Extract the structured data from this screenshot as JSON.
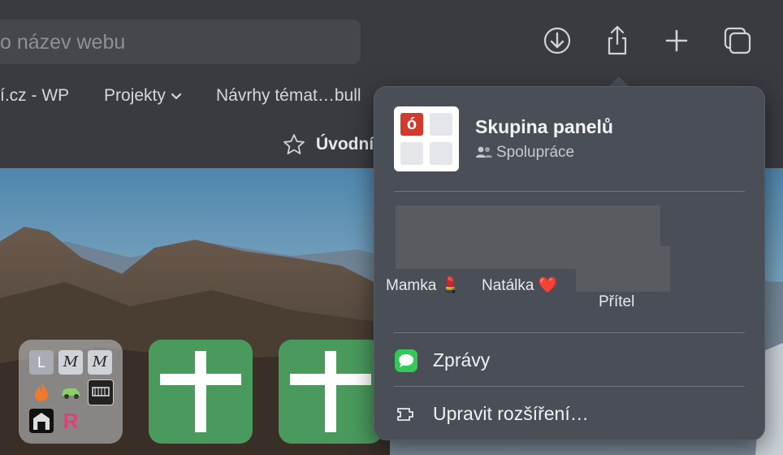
{
  "window": {
    "url_placeholder": "o název webu"
  },
  "bookmarks": [
    {
      "label": "í.cz - WP",
      "has_menu": false
    },
    {
      "label": "Projekty",
      "has_menu": true
    },
    {
      "label": "Návrhy témat…bull",
      "has_menu": false
    }
  ],
  "tab": {
    "label": "Úvodní"
  },
  "toolbar_icons": [
    "download-icon",
    "share-icon",
    "new-tab-icon",
    "tab-overview-icon"
  ],
  "start_page": {
    "folder_tile": {
      "items": [
        "L",
        "M",
        "M",
        "flame",
        "car",
        "film",
        "gate",
        "R"
      ]
    }
  },
  "share_popover": {
    "group_title": "Skupina panelů",
    "group_subtitle": "Spolupráce",
    "contacts": [
      {
        "label": "Mamka 💄"
      },
      {
        "label": "Natálka ❤️"
      },
      {
        "label": "Přítel"
      }
    ],
    "menu_items": [
      {
        "label": "Zprávy",
        "icon": "messages-icon"
      },
      {
        "label": "Upravit rozšíření…",
        "icon": "extensions-icon"
      }
    ]
  },
  "colors": {
    "toolbar": "#393b40",
    "popover": "#4a4f57",
    "tile_green": "#4a9a5d",
    "messages_green": "#34c759"
  }
}
